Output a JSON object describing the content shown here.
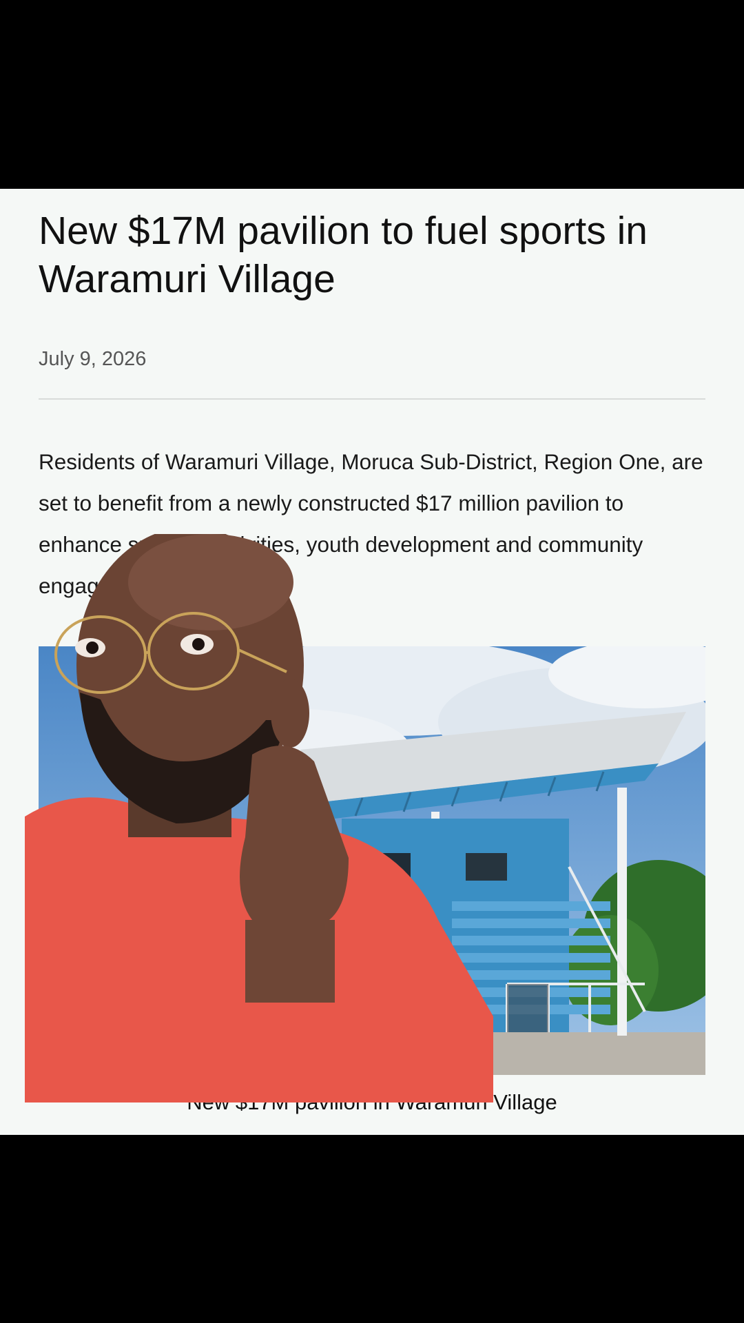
{
  "article": {
    "title": "New $17M pavilion to fuel sports in Waramuri Village",
    "date": "July 9, 2026",
    "lead": "Residents of Waramuri Village, Moruca Sub-District, Region One, are set to benefit from a newly constructed $17 million pavilion to enhance sporting activities, youth development and community engagements.",
    "caption": "New $17M pavilion in Waramuri Village"
  },
  "colors": {
    "page_background": "#f5f8f6",
    "letterbox": "#000000",
    "pavilion_blue": "#3a8fc4",
    "shirt": "#e8574a"
  },
  "icons": {
    "photo": "pavilion-photo",
    "overlay": "presenter-video-overlay"
  }
}
